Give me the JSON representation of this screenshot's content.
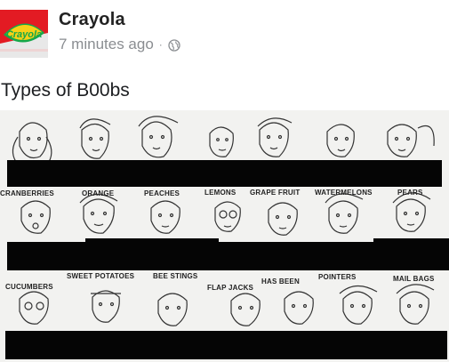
{
  "post": {
    "author": "Crayola",
    "timestamp": "7 minutes ago",
    "separator": "·",
    "privacy_icon": "globe-icon",
    "text": "Types of B00bs"
  },
  "avatar": {
    "logo_text": "Crayola",
    "brand_color": "#e31b23",
    "logo_yellow": "#f7d117",
    "logo_green": "#15a84a"
  },
  "illustration": {
    "row1_labels": [
      "CRANBERRIES",
      "ORANGE",
      "PEACHES",
      "LEMONS",
      "GRAPE FRUIT",
      "WATERMELONS",
      "PEARS"
    ],
    "row2_labels": [
      "CUCUMBERS",
      "SWEET POTATOES",
      "BEE STINGS",
      "FLAP JACKS",
      "HAS BEEN",
      "POINTERS",
      "MAIL BAGS"
    ]
  }
}
